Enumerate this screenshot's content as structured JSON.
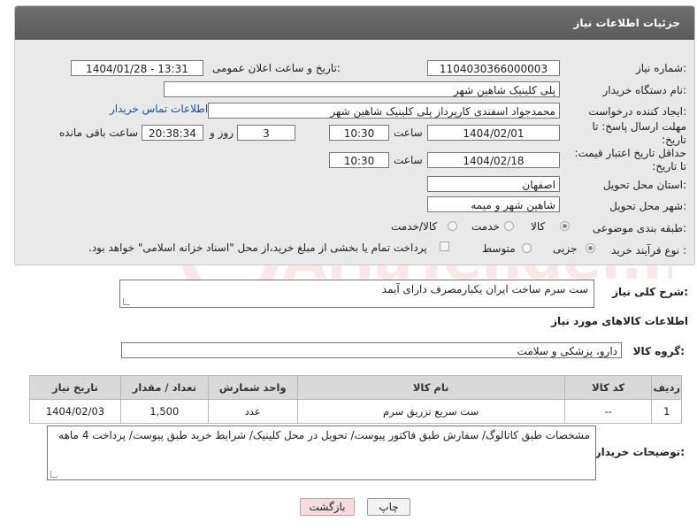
{
  "panel": {
    "title": "جزئیات اطلاعات نیاز"
  },
  "fields": {
    "need_number_label": "شماره نیاز:",
    "need_number_value": "1104030366000003",
    "announce_label": "تاریخ و ساعت اعلان عمومی:",
    "announce_value": "1404/01/28 - 13:31",
    "buyer_org_label": "نام دستگاه خریدار:",
    "buyer_org_value": "پلی کلینیک شاهین شهر",
    "creator_label": "ایجاد کننده درخواست:",
    "creator_value": "محمدجواد اسفندی کارپرداز پلی کلینیک شاهین شهر",
    "contact_link": "اطلاعات تماس خریدار",
    "deadline_label": "مهلت ارسال پاسخ: تا تاریخ:",
    "deadline_date": "1404/02/01",
    "hour_label": "ساعت",
    "deadline_time": "10:30",
    "days_value": "3",
    "day_and_label": "روز و",
    "remaining_time": "20:38:34",
    "remaining_label": "ساعت باقی مانده",
    "validity_label": "حداقل تاریخ اعتبار قیمت: تا تاریخ:",
    "validity_date": "1404/02/18",
    "validity_time": "10:30",
    "province_label": "استان محل تحویل:",
    "province_value": "اصفهان",
    "city_label": "شهر محل تحویل:",
    "city_value": "شاهین شهر و میمه",
    "category_label": "طبقه بندی موضوعی:",
    "category_options": [
      "کالا",
      "خدمت",
      "کالا/خدمت"
    ],
    "category_selected": "کالا",
    "process_label": "نوع فرآیند خرید :",
    "process_options": [
      "جزیی",
      "متوسط"
    ],
    "process_selected": "جزیی",
    "payment_note": "پرداخت تمام یا بخشی از مبلغ خرید،از محل \"اسناد خزانه اسلامی\" خواهد بود."
  },
  "description": {
    "label": "شرح کلی نیاز:",
    "value": "ست سرم ساخت ایران یکبارمصرف دارای آیمد"
  },
  "goods_section": {
    "title": "اطلاعات کالاهای مورد نیاز",
    "group_label": "گروه کالا:",
    "group_value": "دارو، پزشکی و سلامت"
  },
  "table": {
    "headers": [
      "ردیف",
      "کد کالا",
      "نام کالا",
      "واحد شمارش",
      "تعداد / مقدار",
      "تاریخ نیاز"
    ],
    "rows": [
      [
        "1",
        "--",
        "ست سریع تزریق سرم",
        "عدد",
        "1,500",
        "1404/02/03"
      ]
    ]
  },
  "buyer_notes": {
    "label": "توضیحات خریدار:",
    "value": "مشخصات طبق کاتالوگ/ سفارش طبق فاکتور پیوست/ تحویل در محل کلینیک/ شرایط خرید طبق پیوست/ پرداخت 4 ماهه"
  },
  "buttons": {
    "print": "چاپ",
    "back": "بازگشت"
  },
  "watermark": {
    "text": "AriaTender.net"
  },
  "colors": {
    "header": "#5f5f5f",
    "link": "#1a4fa0",
    "back_button": "#f8dcdc"
  }
}
